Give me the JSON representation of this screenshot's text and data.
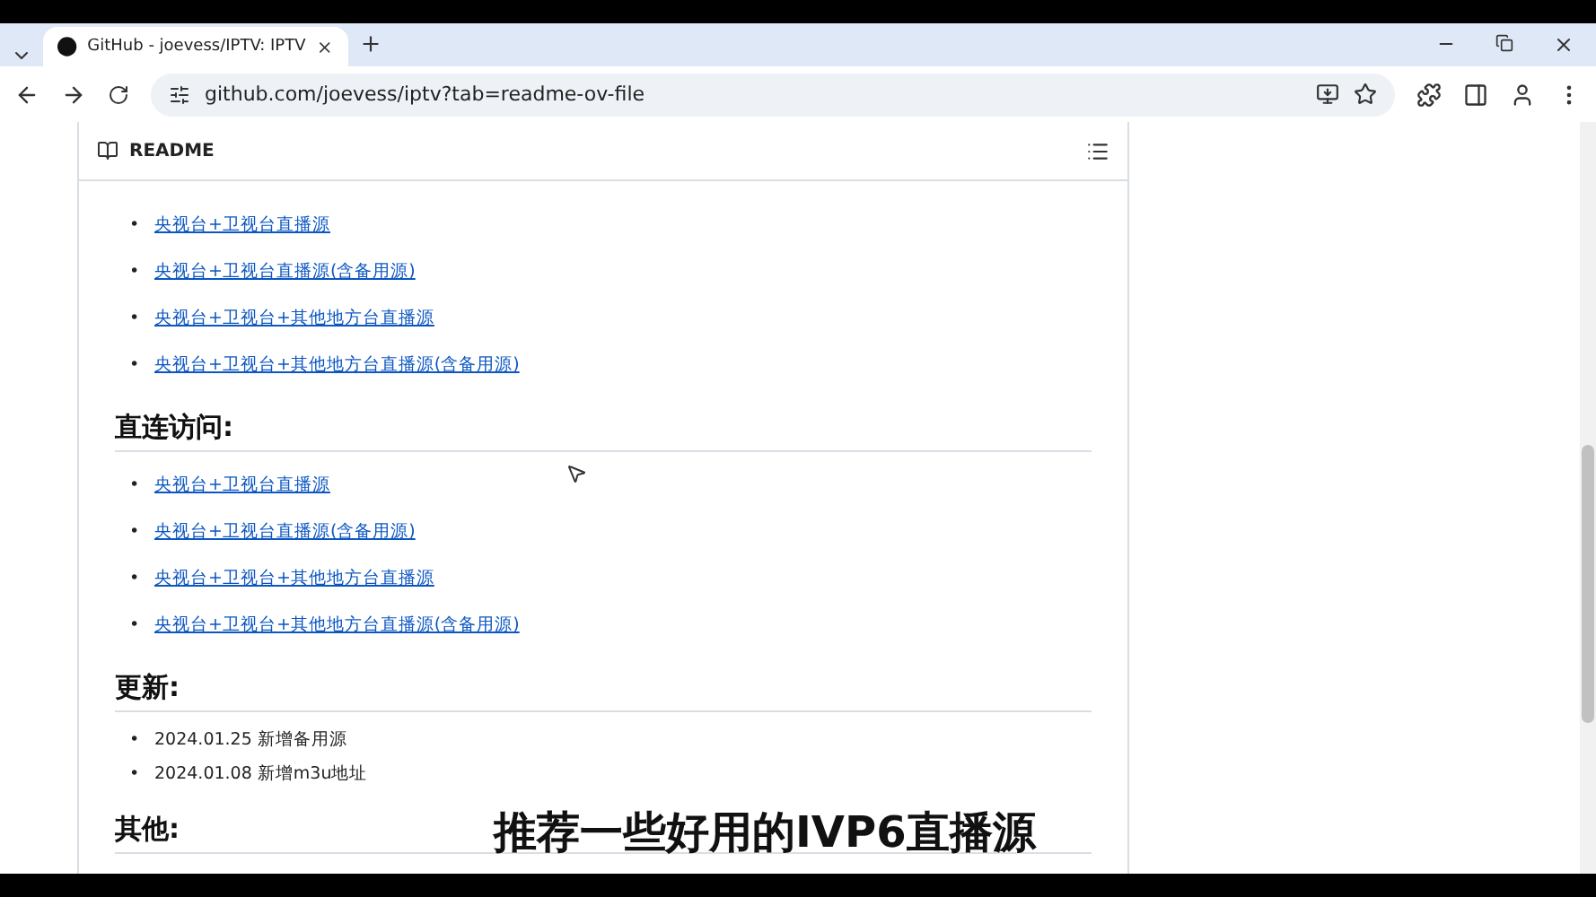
{
  "browser": {
    "tab_title": "GitHub - joevess/IPTV: IPTV",
    "url": "github.com/joevess/iptv?tab=readme-ov-file"
  },
  "readme": {
    "title": "README",
    "bullet": "•",
    "sections": [
      {
        "kind": "links",
        "items": [
          "央视台+卫视台直播源",
          "央视台+卫视台直播源(含备用源)",
          "央视台+卫视台+其他地方台直播源",
          "央视台+卫视台+其他地方台直播源(含备用源)"
        ]
      },
      {
        "kind": "links",
        "heading": "直连访问:",
        "items": [
          "央视台+卫视台直播源",
          "央视台+卫视台直播源(含备用源)",
          "央视台+卫视台+其他地方台直播源",
          "央视台+卫视台+其他地方台直播源(含备用源)"
        ]
      },
      {
        "kind": "plain",
        "heading": "更新:",
        "items": [
          "2024.01.25 新增备用源",
          "2024.01.08 新增m3u地址"
        ]
      },
      {
        "kind": "heading",
        "heading": "其他:"
      }
    ]
  },
  "caption": "推荐一些好用的IVP6直播源"
}
